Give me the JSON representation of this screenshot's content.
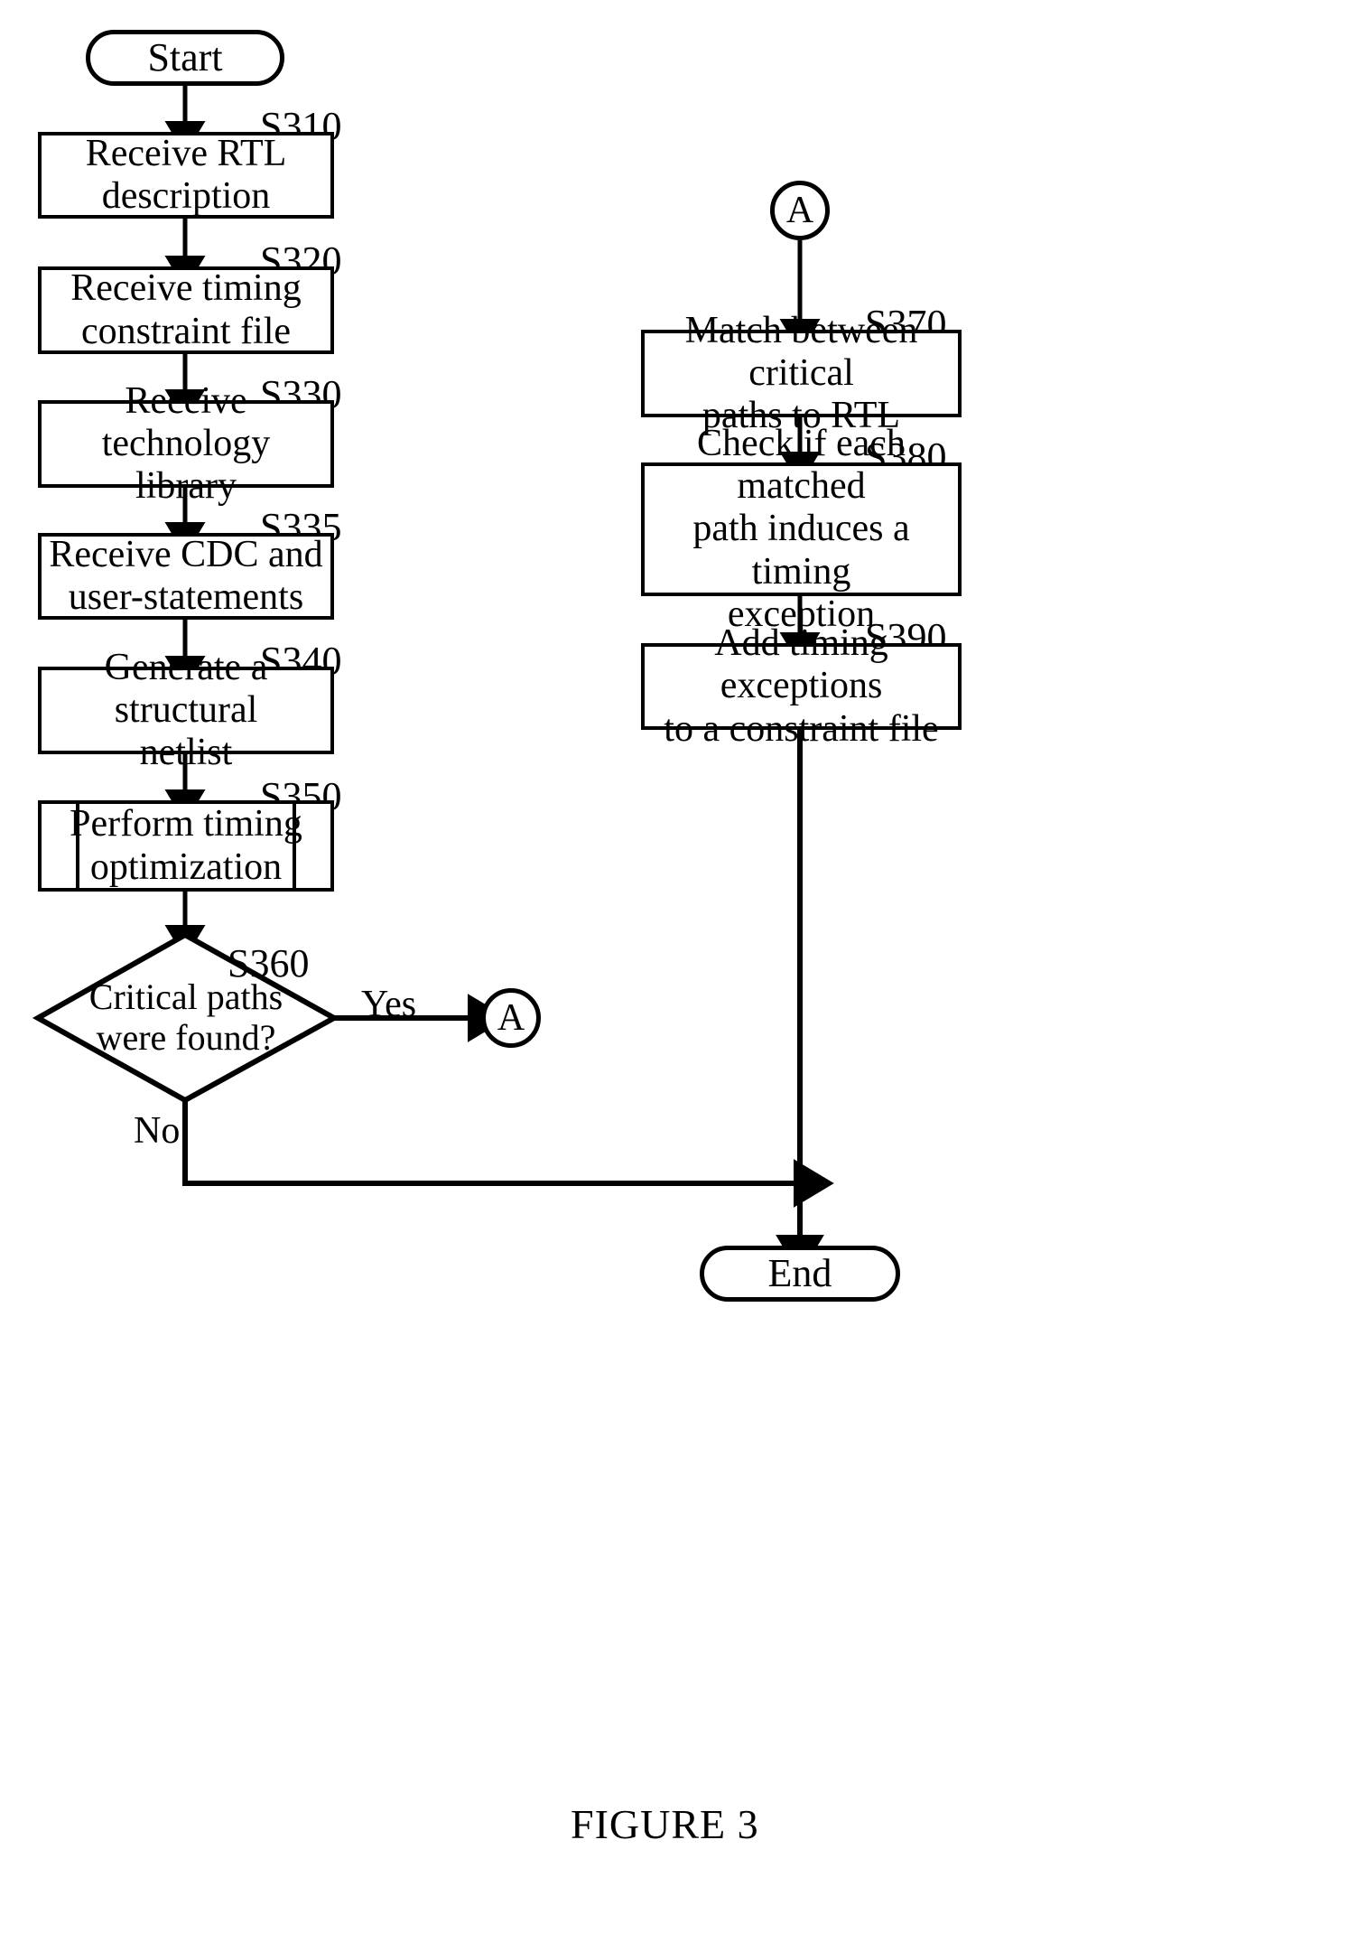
{
  "figure": {
    "caption": "FIGURE 3"
  },
  "terminals": {
    "start": "Start",
    "end": "End"
  },
  "connectors": {
    "a_target": "A",
    "a_source": "A"
  },
  "branch_labels": {
    "yes": "Yes",
    "no": "No"
  },
  "steps": [
    {
      "id": "S310",
      "text": "Receive RTL description",
      "line1": "Receive RTL",
      "line2": "description"
    },
    {
      "id": "S320",
      "text": "Receive timing constraint file",
      "line1": "Receive timing",
      "line2": "constraint file"
    },
    {
      "id": "S330",
      "text": "Receive technology library",
      "line1": "Receive technology",
      "line2": "library"
    },
    {
      "id": "S335",
      "text": "Receive CDC and user-statements",
      "line1": "Receive CDC and",
      "line2": "user-statements"
    },
    {
      "id": "S340",
      "text": "Generate a structural netlist",
      "line1": "Generate a structural",
      "line2": "netlist"
    },
    {
      "id": "S350",
      "text": "Perform timing optimization",
      "line1": "Perform timing",
      "line2": "optimization"
    },
    {
      "id": "S360",
      "text": "Critical paths were found?",
      "line1": "Critical paths",
      "line2": "were found?"
    },
    {
      "id": "S370",
      "text": "Match between critical paths to RTL",
      "line1": "Match between critical",
      "line2": "paths to RTL"
    },
    {
      "id": "S380",
      "text": "Check if each matched path induces a timing exception",
      "line1": "Check if each matched",
      "line2": "path induces a timing",
      "line3": "exception"
    },
    {
      "id": "S390",
      "text": "Add timing exceptions to a constraint file",
      "line1": "Add timing exceptions",
      "line2": "to a constraint file"
    }
  ],
  "colors": {
    "stroke": "#000000",
    "background": "#ffffff"
  }
}
